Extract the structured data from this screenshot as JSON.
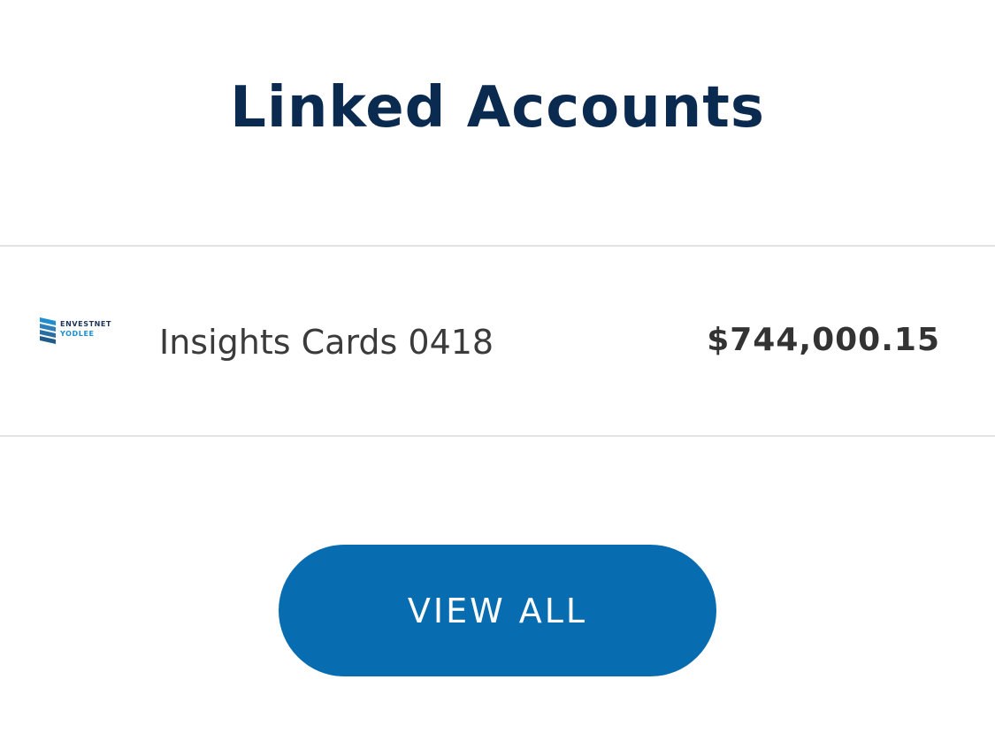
{
  "header": {
    "title": "Linked Accounts"
  },
  "accounts": [
    {
      "provider_logo": {
        "icon": "envestnet-yodlee-logo",
        "line1": "ENVESTNET",
        "line2": "YODLEE",
        "colors": {
          "dark": "#1d3559",
          "accent": "#1d8fcf"
        }
      },
      "name": "Insights Cards 0418",
      "balance": "$744,000.15"
    }
  ],
  "actions": {
    "view_all_label": "VIEW ALL"
  },
  "theme": {
    "title_color": "#0b2a4f",
    "button_color": "#086db0",
    "divider_color": "#e1e3e6"
  }
}
